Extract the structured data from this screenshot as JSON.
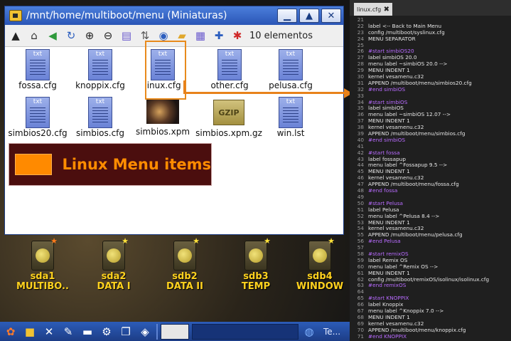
{
  "window": {
    "title": "/mnt/home/multiboot/menu (Miniaturas)",
    "toolbar_count": "10 elementos",
    "buttons": {
      "minimize": "▁",
      "maximize": "▲",
      "close": "✕"
    },
    "files": [
      {
        "name": "fossa.cfg",
        "ext": "txt",
        "kind": "doc"
      },
      {
        "name": "knoppix.cfg",
        "ext": "txt",
        "kind": "doc"
      },
      {
        "name": "linux.cfg",
        "ext": "txt",
        "kind": "doc"
      },
      {
        "name": "other.cfg",
        "ext": "txt",
        "kind": "doc"
      },
      {
        "name": "pelusa.cfg",
        "ext": "txt",
        "kind": "doc"
      },
      {
        "name": "simbios20.cfg",
        "ext": "txt",
        "kind": "doc"
      },
      {
        "name": "simbios.cfg",
        "ext": "txt",
        "kind": "doc"
      },
      {
        "name": "simbios.xpm",
        "ext": "",
        "kind": "image"
      },
      {
        "name": "simbios.xpm.gz",
        "ext": "GZIP",
        "kind": "gzip"
      },
      {
        "name": "win.lst",
        "ext": "txt",
        "kind": "doc"
      }
    ]
  },
  "banner": {
    "text": "Linux Menu items",
    "color": "#ff8c00"
  },
  "desktop_icons": [
    {
      "line1": "sda1",
      "line2": "MULTIBO..",
      "star": "orange"
    },
    {
      "line1": "sda2",
      "line2": "DATA I",
      "star": "yellow"
    },
    {
      "line1": "sdb2",
      "line2": "DATA II",
      "star": "yellow"
    },
    {
      "line1": "sdb3",
      "line2": "TEMP",
      "star": "yellow"
    },
    {
      "line1": "sdb4",
      "line2": "WINDOW",
      "star": "yellow"
    }
  ],
  "taskbar": {
    "task_label": "Te..."
  },
  "editor": {
    "tab_name": "linux.cfg",
    "lines": [
      {
        "n": "21",
        "t": "",
        "c": false
      },
      {
        "n": "22",
        "t": "label <-- Back to Main Menu",
        "c": false
      },
      {
        "n": "23",
        "t": "config /multiboot/syslinux.cfg",
        "c": false
      },
      {
        "n": "24",
        "t": "MENU SEPARATOR",
        "c": false
      },
      {
        "n": "25",
        "t": "",
        "c": false
      },
      {
        "n": "26",
        "t": "#start simbiOS20",
        "c": true
      },
      {
        "n": "27",
        "t": "label simbiOS 20.0",
        "c": false
      },
      {
        "n": "28",
        "t": "menu label ~simbiOS 20.0 -->",
        "c": false
      },
      {
        "n": "29",
        "t": "MENU INDENT 1",
        "c": false
      },
      {
        "n": "30",
        "t": "kernel vesamenu.c32",
        "c": false
      },
      {
        "n": "31",
        "t": "APPEND /multiboot/menu/simbios20.cfg",
        "c": false
      },
      {
        "n": "32",
        "t": "#end simbiOS",
        "c": true
      },
      {
        "n": "33",
        "t": "",
        "c": false
      },
      {
        "n": "34",
        "t": "#start simbiOS",
        "c": true
      },
      {
        "n": "35",
        "t": "label simbiOS",
        "c": false
      },
      {
        "n": "36",
        "t": "menu label ~simbiOS 12.07 -->",
        "c": false
      },
      {
        "n": "37",
        "t": "MENU INDENT 1",
        "c": false
      },
      {
        "n": "38",
        "t": "kernel vesamenu.c32",
        "c": false
      },
      {
        "n": "39",
        "t": "APPEND /multiboot/menu/simbios.cfg",
        "c": false
      },
      {
        "n": "40",
        "t": "#end simbiOS",
        "c": true
      },
      {
        "n": "41",
        "t": "",
        "c": false
      },
      {
        "n": "42",
        "t": "#start fossa",
        "c": true
      },
      {
        "n": "43",
        "t": "label fossapup",
        "c": false
      },
      {
        "n": "44",
        "t": "menu label ^Fossapup 9.5 -->",
        "c": false
      },
      {
        "n": "45",
        "t": "MENU INDENT 1",
        "c": false
      },
      {
        "n": "46",
        "t": "kernel vesamenu.c32",
        "c": false
      },
      {
        "n": "47",
        "t": "APPEND /multiboot/menu/fossa.cfg",
        "c": false
      },
      {
        "n": "48",
        "t": "#end fossa",
        "c": true
      },
      {
        "n": "49",
        "t": "",
        "c": false
      },
      {
        "n": "50",
        "t": "#start Pelusa",
        "c": true
      },
      {
        "n": "51",
        "t": "label Pelusa",
        "c": false
      },
      {
        "n": "52",
        "t": "menu label ^Pelusa 8.4 -->",
        "c": false
      },
      {
        "n": "53",
        "t": "MENU INDENT 1",
        "c": false
      },
      {
        "n": "54",
        "t": "kernel vesamenu.c32",
        "c": false
      },
      {
        "n": "55",
        "t": "APPEND /multiboot/menu/pelusa.cfg",
        "c": false
      },
      {
        "n": "56",
        "t": "#end Pelusa",
        "c": true
      },
      {
        "n": "57",
        "t": "",
        "c": false
      },
      {
        "n": "58",
        "t": "#start remixOS",
        "c": true
      },
      {
        "n": "59",
        "t": "label Remix OS",
        "c": false
      },
      {
        "n": "60",
        "t": "menu label ^Remix OS -->",
        "c": false
      },
      {
        "n": "61",
        "t": "MENU INDENT 1",
        "c": false
      },
      {
        "n": "62",
        "t": "config /multiboot/remixOS/isolinux/isolinux.cfg",
        "c": false
      },
      {
        "n": "63",
        "t": "#end remixOS",
        "c": true
      },
      {
        "n": "64",
        "t": "",
        "c": false
      },
      {
        "n": "65",
        "t": "#start KNOPPIX",
        "c": true
      },
      {
        "n": "66",
        "t": "label Knoppix",
        "c": false
      },
      {
        "n": "67",
        "t": "menu label ^Knoppix 7.0 -->",
        "c": false
      },
      {
        "n": "68",
        "t": "MENU INDENT 1",
        "c": false
      },
      {
        "n": "69",
        "t": "kernel vesamenu.c32",
        "c": false
      },
      {
        "n": "70",
        "t": "APPEND /multiboot/menu/knoppix.cfg",
        "c": false
      },
      {
        "n": "71",
        "t": "#end KNOPPIX",
        "c": true
      }
    ]
  }
}
